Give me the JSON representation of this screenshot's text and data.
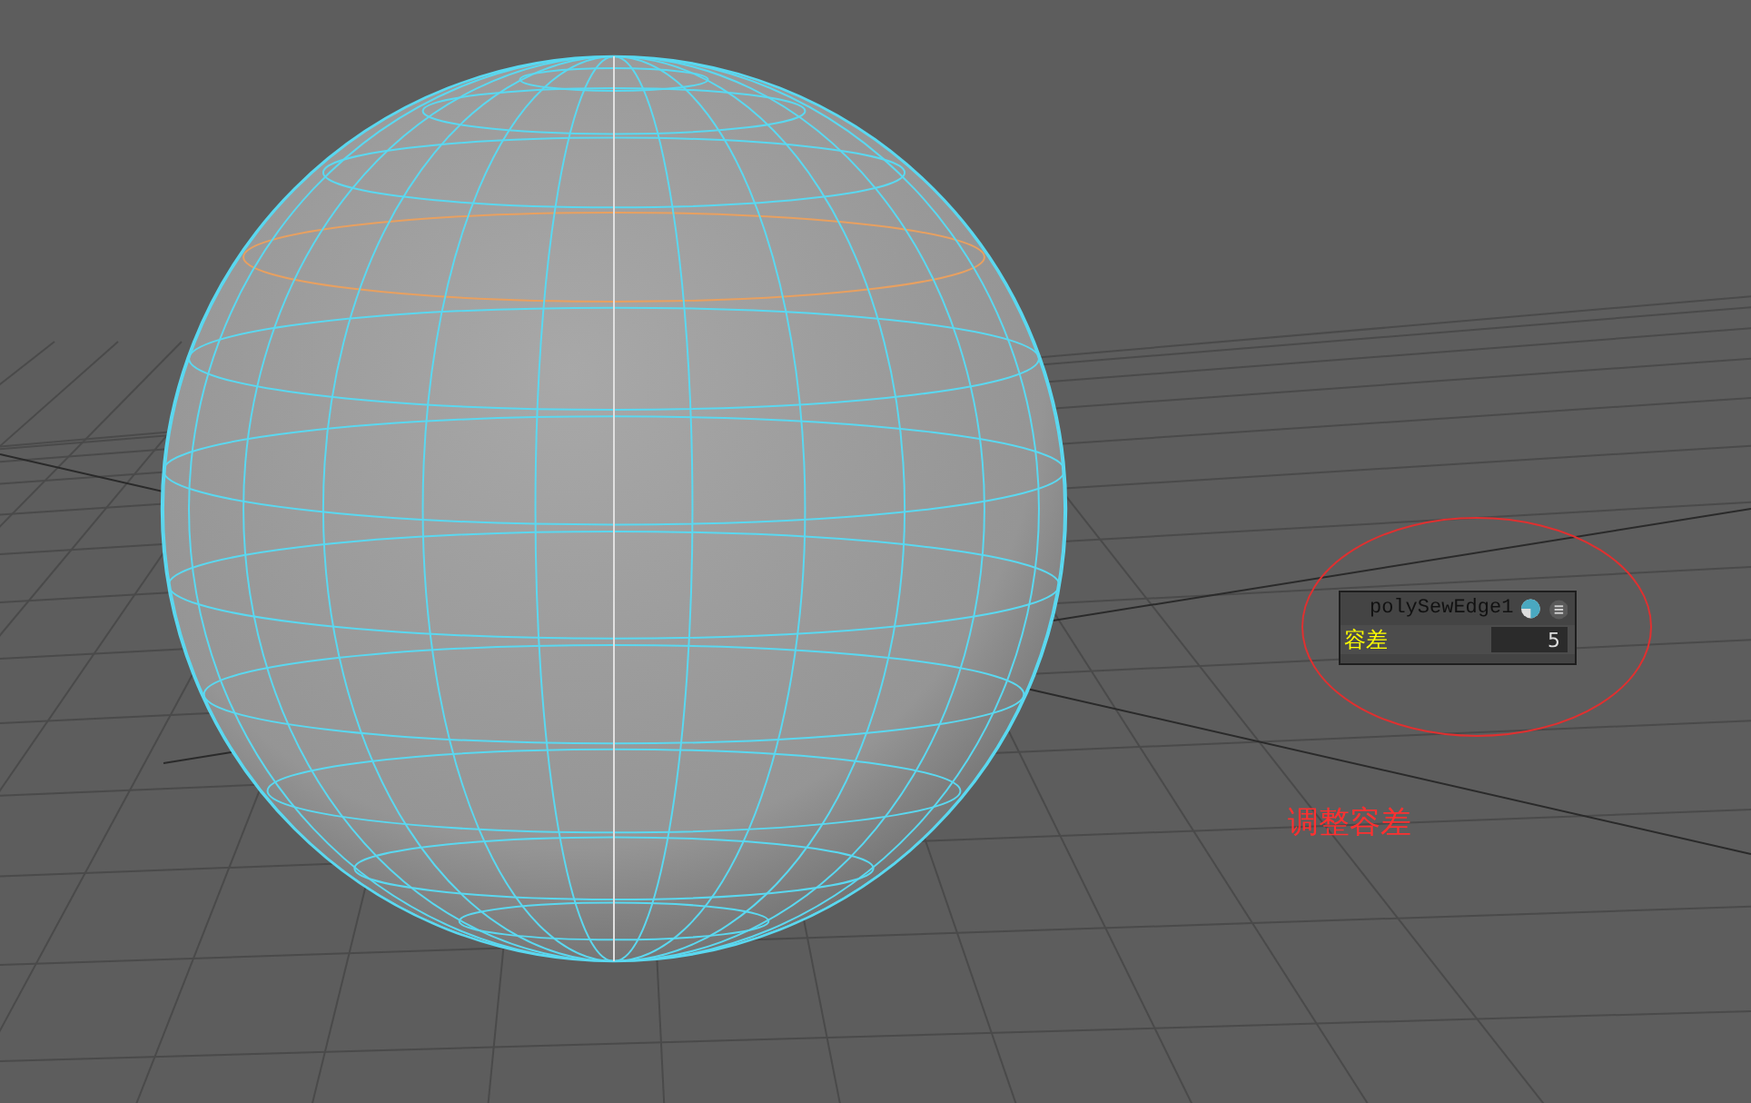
{
  "viewport": {
    "node_panel": {
      "title": "polySewEdge1",
      "attribute": {
        "label": "容差",
        "value": "5"
      }
    },
    "annotation": {
      "text": "调整容差"
    }
  }
}
